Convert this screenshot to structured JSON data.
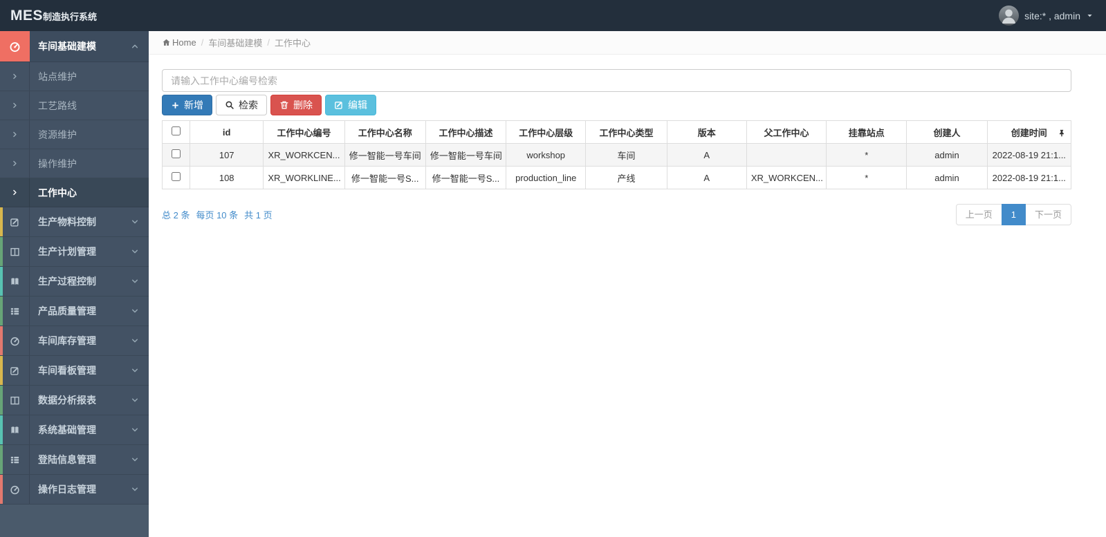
{
  "brand": {
    "mes": "MES",
    "suffix": "制造执行系统"
  },
  "topbar": {
    "user": "site:* , admin"
  },
  "sidebar": {
    "group_active": {
      "label": "车间基础建模",
      "icon": "dashboard-icon"
    },
    "submenu": [
      {
        "label": "站点维护",
        "active": false
      },
      {
        "label": "工艺路线",
        "active": false
      },
      {
        "label": "资源维护",
        "active": false
      },
      {
        "label": "操作维护",
        "active": false
      },
      {
        "label": "工作中心",
        "active": true
      }
    ],
    "groups": [
      {
        "label": "生产物料控制",
        "icon": "edit-icon",
        "strip": "#d8b74e"
      },
      {
        "label": "生产计划管理",
        "icon": "columns-icon",
        "strip": "#67a477"
      },
      {
        "label": "生产过程控制",
        "icon": "book-icon",
        "strip": "#58c2b2"
      },
      {
        "label": "产品质量管理",
        "icon": "list-icon",
        "strip": "#67a477"
      },
      {
        "label": "车间库存管理",
        "icon": "dashboard-icon",
        "strip": "#e2796f"
      },
      {
        "label": "车间看板管理",
        "icon": "edit-icon",
        "strip": "#d8b74e"
      },
      {
        "label": "数据分析报表",
        "icon": "columns-icon",
        "strip": "#67a477"
      },
      {
        "label": "系统基础管理",
        "icon": "book-icon",
        "strip": "#58c2b2"
      },
      {
        "label": "登陆信息管理",
        "icon": "list-icon",
        "strip": "#67a477"
      },
      {
        "label": "操作日志管理",
        "icon": "dashboard-icon",
        "strip": "#e2796f"
      }
    ]
  },
  "breadcrumb": {
    "home": "Home",
    "sep": "/",
    "items": [
      "车间基础建模",
      "工作中心"
    ]
  },
  "search": {
    "placeholder": "请输入工作中心编号检索"
  },
  "toolbar": {
    "add": "新增",
    "search": "检索",
    "delete": "删除",
    "edit": "编辑"
  },
  "table": {
    "headers": [
      "id",
      "工作中心编号",
      "工作中心名称",
      "工作中心描述",
      "工作中心层级",
      "工作中心类型",
      "版本",
      "父工作中心",
      "挂靠站点",
      "创建人",
      "创建时间"
    ],
    "rows": [
      {
        "cells": [
          "107",
          "XR_WORKCEN...",
          "修一智能一号车间",
          "修一智能一号车间",
          "workshop",
          "车间",
          "A",
          "",
          "*",
          "admin",
          "2022-08-19 21:1..."
        ]
      },
      {
        "cells": [
          "108",
          "XR_WORKLINE...",
          "修一智能一号S...",
          "修一智能一号S...",
          "production_line",
          "产线",
          "A",
          "XR_WORKCEN...",
          "*",
          "admin",
          "2022-08-19 21:1..."
        ]
      }
    ]
  },
  "pagination": {
    "summary_total": "总 2 条",
    "summary_per": "每页 10 条",
    "summary_pages": "共 1 页",
    "prev": "上一页",
    "page": "1",
    "next": "下一页"
  },
  "colors": {
    "topbar_bg": "#232f3c",
    "sidebar_bg": "#435264",
    "active_group_icon_bg": "#ef6f63",
    "primary_button": "#337ab7",
    "danger_button": "#d9534f",
    "info_button": "#5bc0de",
    "link_blue": "#428bca",
    "pager_active_bg": "#428bca",
    "strip_yellow": "#d8b74e",
    "strip_green": "#67a477",
    "strip_teal": "#58c2b2",
    "strip_red": "#e2796f"
  }
}
